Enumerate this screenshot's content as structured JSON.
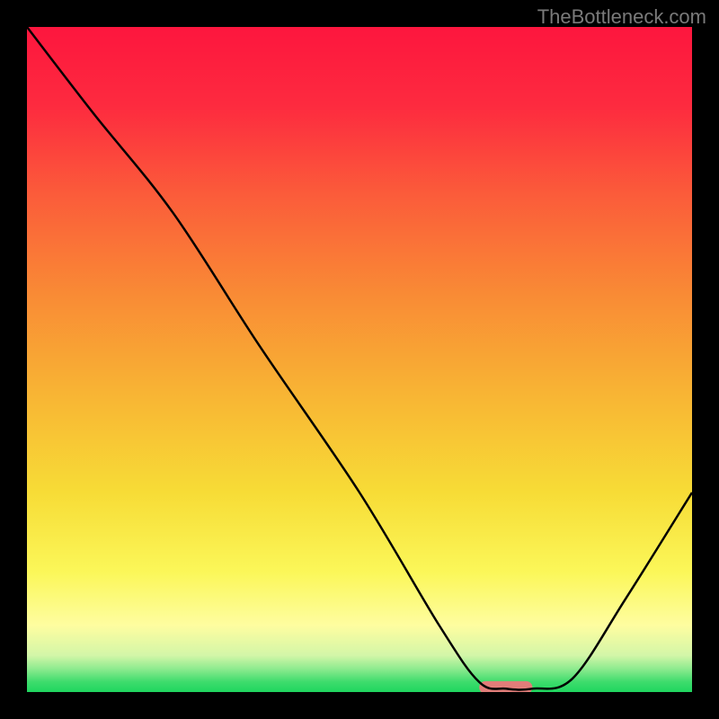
{
  "watermark": "TheBottleneck.com",
  "gradient": {
    "stops": [
      {
        "offset": 0.0,
        "color": "#fd163e"
      },
      {
        "offset": 0.12,
        "color": "#fd2b3f"
      },
      {
        "offset": 0.25,
        "color": "#fb5b3a"
      },
      {
        "offset": 0.4,
        "color": "#f98a35"
      },
      {
        "offset": 0.55,
        "color": "#f8b434"
      },
      {
        "offset": 0.7,
        "color": "#f7dc36"
      },
      {
        "offset": 0.82,
        "color": "#fbf759"
      },
      {
        "offset": 0.9,
        "color": "#fefda0"
      },
      {
        "offset": 0.945,
        "color": "#d3f6a8"
      },
      {
        "offset": 0.965,
        "color": "#8eeb8f"
      },
      {
        "offset": 0.985,
        "color": "#3ddc6c"
      },
      {
        "offset": 1.0,
        "color": "#1fd65f"
      }
    ]
  },
  "chart_data": {
    "type": "line",
    "title": "",
    "xlabel": "",
    "ylabel": "",
    "xlim": [
      0,
      100
    ],
    "ylim": [
      0,
      100
    ],
    "series": [
      {
        "name": "curve",
        "x": [
          0,
          10,
          22,
          35,
          50,
          62,
          68,
          72,
          76,
          82,
          90,
          100
        ],
        "y": [
          100,
          87,
          72,
          52,
          30,
          10,
          1.5,
          0.5,
          0.5,
          2,
          14,
          30
        ]
      }
    ],
    "marker": {
      "x_start": 68,
      "x_end": 76,
      "y": 0.7,
      "color": "#e17d79"
    }
  }
}
